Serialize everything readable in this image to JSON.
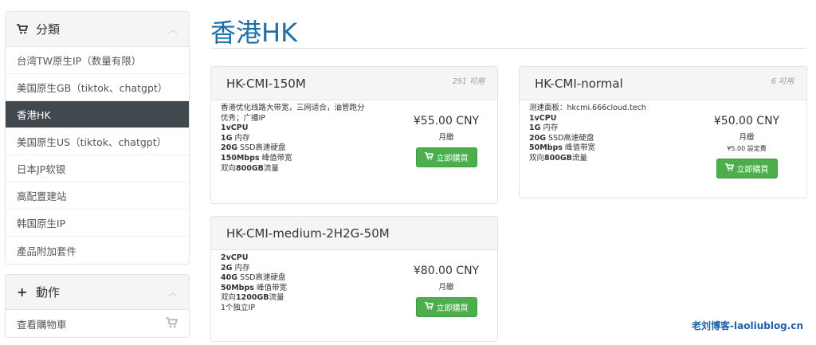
{
  "sidebar": {
    "categories_title": "分類",
    "categories": [
      {
        "label": "台湾TW原生IP（数量有限）",
        "active": false
      },
      {
        "label": "美国原生GB（tiktok、chatgpt）",
        "active": false
      },
      {
        "label": "香港HK",
        "active": true
      },
      {
        "label": "美国原生US（tiktok、chatgpt）",
        "active": false
      },
      {
        "label": "日本JP软银",
        "active": false
      },
      {
        "label": "高配置建站",
        "active": false
      },
      {
        "label": "韩国原生IP",
        "active": false
      },
      {
        "label": "產品附加套件",
        "active": false
      }
    ],
    "actions_title": "動作",
    "actions": [
      {
        "label": "查看購物車"
      }
    ]
  },
  "main": {
    "title": "香港HK"
  },
  "products": [
    {
      "name": "HK-CMI-150M",
      "availability": "291 可用",
      "features": [
        {
          "bold": "",
          "text": "香港优化线路大带宽，三网适合，油管跑分"
        },
        {
          "bold": "",
          "text": "优秀；广播IP"
        },
        {
          "bold": "1vCPU",
          "text": ""
        },
        {
          "bold": "1G",
          "text": " 内存"
        },
        {
          "bold": "20G",
          "text": " SSD高速硬盘"
        },
        {
          "bold": "150Mbps",
          "text": " 峰值带宽"
        },
        {
          "bold": "",
          "text": "双向",
          "bold2": "800GB",
          "text2": "流量"
        }
      ],
      "price": "¥55.00 CNY",
      "cycle": "月繳",
      "setup": "",
      "buy_label": "立即購買"
    },
    {
      "name": "HK-CMI-normal",
      "availability": "6 可用",
      "features": [
        {
          "bold": "",
          "text": "测速面板：hkcmi.666cloud.tech"
        },
        {
          "bold": "1vCPU",
          "text": ""
        },
        {
          "bold": "1G",
          "text": " 内存"
        },
        {
          "bold": "20G",
          "text": " SSD高速硬盘"
        },
        {
          "bold": "50Mbps",
          "text": " 峰值带宽"
        },
        {
          "bold": "",
          "text": "双向",
          "bold2": "800GB",
          "text2": "流量"
        }
      ],
      "price": "¥50.00 CNY",
      "cycle": "月繳",
      "setup": "¥5.00 設定費",
      "buy_label": "立即購買"
    },
    {
      "name": "HK-CMI-medium-2H2G-50M",
      "availability": "",
      "features": [
        {
          "bold": "2vCPU",
          "text": ""
        },
        {
          "bold": "2G",
          "text": " 内存"
        },
        {
          "bold": "40G",
          "text": " SSD高速硬盘"
        },
        {
          "bold": "50Mbps",
          "text": " 峰值带宽"
        },
        {
          "bold": "",
          "text": "双向",
          "bold2": "1200GB",
          "text2": "流量"
        },
        {
          "bold": "",
          "text": "1个独立IP"
        }
      ],
      "price": "¥80.00 CNY",
      "cycle": "月繳",
      "setup": "",
      "buy_label": "立即購買"
    }
  ],
  "watermark": "老刘博客-laoliublog.cn",
  "colors": {
    "title": "#1e6fa8",
    "buy_button": "#4cae4c",
    "active_nav": "#41494f"
  }
}
